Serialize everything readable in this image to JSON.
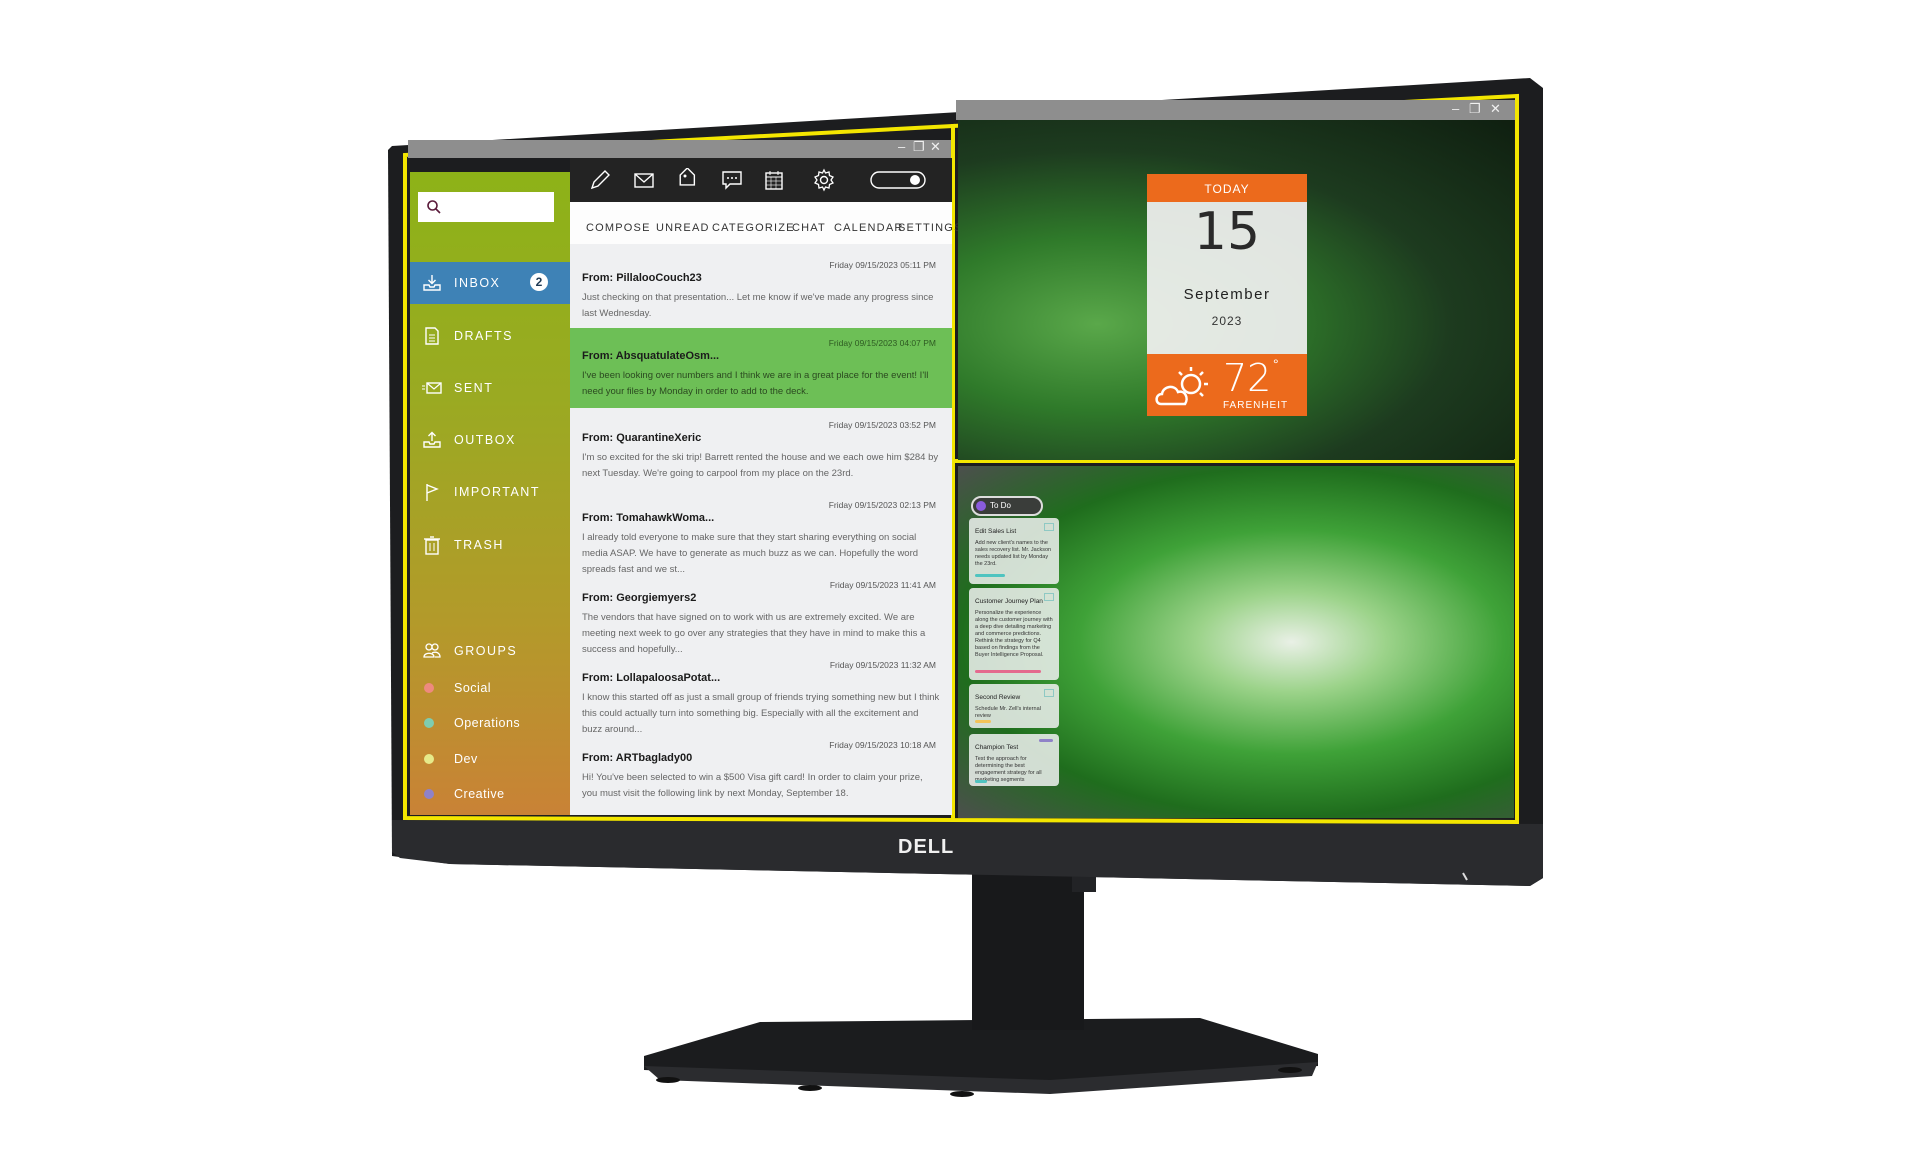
{
  "device": {
    "brand_logo": "DELL"
  },
  "mail_app": {
    "window_controls": [
      "minimize-icon",
      "restore-icon",
      "close-icon"
    ],
    "search": {
      "placeholder": "",
      "value": "",
      "icon": "search-icon"
    },
    "toolbar_icons": [
      "pencil-icon",
      "envelope-icon",
      "tag-icon",
      "chat-bubble-icon",
      "calendar-icon",
      "gear-icon",
      "toggle-switch-icon"
    ],
    "menu": [
      "COMPOSE",
      "UNREAD",
      "CATEGORIZE",
      "CHAT",
      "CALENDAR",
      "SETTINGS"
    ],
    "nav": [
      {
        "label": "INBOX",
        "icon": "inbox-download-icon",
        "badge": "2",
        "active": true
      },
      {
        "label": "DRAFTS",
        "icon": "document-icon"
      },
      {
        "label": "SENT",
        "icon": "sent-envelope-icon"
      },
      {
        "label": "OUTBOX",
        "icon": "outbox-upload-icon"
      },
      {
        "label": "IMPORTANT",
        "icon": "flag-icon"
      },
      {
        "label": "TRASH",
        "icon": "trash-icon"
      }
    ],
    "groups_label": "GROUPS",
    "groups": [
      {
        "label": "Social",
        "color": "#ee8a7e"
      },
      {
        "label": "Operations",
        "color": "#7fcdb0"
      },
      {
        "label": "Dev",
        "color": "#e6ea8a"
      },
      {
        "label": "Creative",
        "color": "#8f82c8"
      }
    ],
    "messages": [
      {
        "from": "From: PillalooCouch23",
        "date": "Friday 09/15/2023 05:11 PM",
        "body": "Just checking on that presentation... Let me know if we've made any progress since last Wednesday.",
        "selected": false
      },
      {
        "from": "From: AbsquatulateOsm...",
        "date": "Friday 09/15/2023 04:07 PM",
        "body": "I've been looking over numbers and I think we are in a great place for the event! I'll need your files by Monday in order to add to the deck.",
        "selected": true
      },
      {
        "from": "From: QuarantineXeric",
        "date": "Friday 09/15/2023 03:52 PM",
        "body": "I'm so excited for the ski trip! Barrett rented the house and we each owe him $284 by next Tuesday. We're going to carpool from my place on the 23rd.",
        "selected": false
      },
      {
        "from": "From: TomahawkWoma...",
        "date": "Friday 09/15/2023 02:13 PM",
        "body": "I already told everyone to make sure that they start sharing everything on social media ASAP. We have to generate as much buzz as we can. Hopefully the word spreads fast and we st...",
        "selected": false
      },
      {
        "from": "From: Georgiemyers2",
        "date": "Friday 09/15/2023 11:41 AM",
        "body": "The vendors that have signed on to work with us are extremely excited. We are meeting next week to go over any strategies that they have in mind to make this a success and hopefully...",
        "selected": false
      },
      {
        "from": "From: LollapaloosaPotat...",
        "date": "Friday 09/15/2023 11:32 AM",
        "body": "I know this started off as just a small group of friends trying something new but I think this could actually turn into something big. Especially with all the excitement and buzz around...",
        "selected": false
      },
      {
        "from": "From: ARTbaglady00",
        "date": "Friday 09/15/2023 10:18 AM",
        "body": "Hi! You've been selected to win a $500 Visa gift card! In order to claim your prize, you must visit the following link by next Monday, September 18.",
        "selected": false
      }
    ]
  },
  "calendar_widget": {
    "header": "TODAY",
    "day": "15",
    "month": "September",
    "year": "2023",
    "weather_icon": "partly-cloudy-icon",
    "temperature": "72",
    "degree_symbol": "°",
    "unit": "FARENHEIT"
  },
  "todo_widget": {
    "title": "To Do",
    "cards": [
      {
        "title": "Edit Sales List",
        "items": [
          "Add new client's names to the sales recovery list. Mr. Jackson needs updated list by Monday the 23rd."
        ],
        "bar_color": "#4fc4c0"
      },
      {
        "title": "Customer Journey Plan",
        "items": [
          "Personalize the experience along the customer journey with a deep dive detailing marketing and commerce predictions.",
          "Rethink the strategy for Q4 based on findings from the Buyer Intelligence Proposal."
        ],
        "bar_color": "#e46a8e"
      },
      {
        "title": "Second Review",
        "items": [
          "Schedule Mr. Zell's internal review"
        ],
        "bar_color": "#f2c45a"
      },
      {
        "title": "Champion Test",
        "items": [
          "Test the approach for determining the best engagement strategy for all marketing segments"
        ],
        "bar_color": "#4fc4c0"
      }
    ]
  },
  "colors": {
    "highlight_border": "#f3e600",
    "inbox_active": "#3e82b6",
    "selected_message": "#6dbf56",
    "widget_orange": "#ec6a1c"
  }
}
